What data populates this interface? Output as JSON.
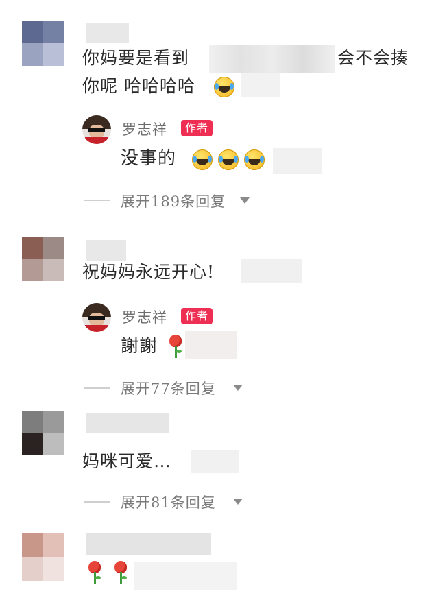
{
  "comments": [
    {
      "text_start": "你妈要是看到",
      "text_end": "会不会揍",
      "text_line2": "你呢 哈哈哈哈",
      "reply": {
        "author": "罗志祥",
        "badge": "作者",
        "text": "没事的"
      },
      "expand": "展开189条回复"
    },
    {
      "text": "祝妈妈永远开心!",
      "reply": {
        "author": "罗志祥",
        "badge": "作者",
        "text": "謝謝"
      },
      "expand": "展开77条回复"
    },
    {
      "text": "妈咪可爱…",
      "expand": "展开81条回复"
    },
    {
      "text": ""
    }
  ],
  "icons": {
    "emoji": "rolling-on-floor-laughing-icon",
    "rose": "rose-icon",
    "caret": "caret-down-icon"
  },
  "colors": {
    "badge": "#ee2e52",
    "muted_text": "#7a7a7a"
  }
}
